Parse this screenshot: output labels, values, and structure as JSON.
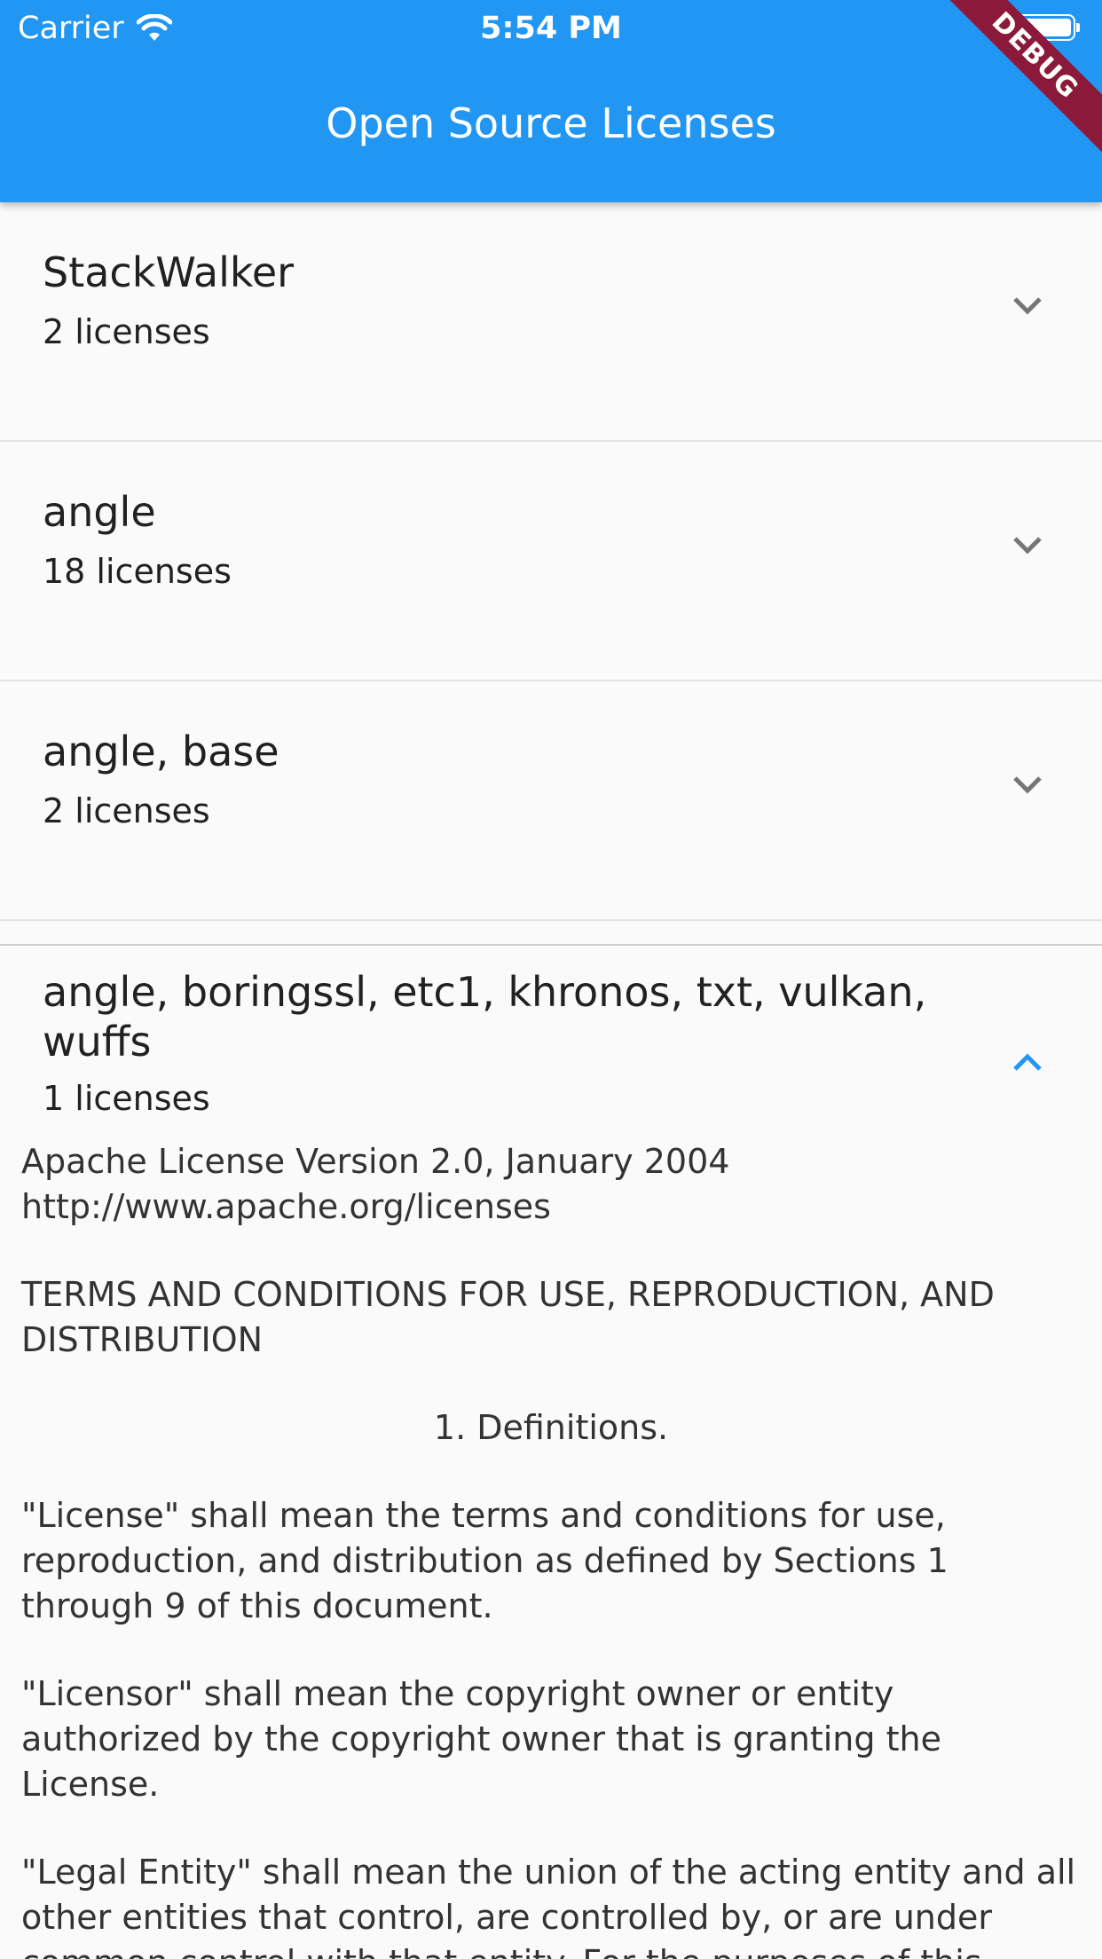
{
  "status_bar": {
    "carrier": "Carrier",
    "time": "5:54 PM"
  },
  "app_bar": {
    "title": "Open Source Licenses",
    "debug_banner": "DEBUG",
    "color": "#2196f3"
  },
  "packages": [
    {
      "name": "StackWalker",
      "count": "2 licenses",
      "icon": "chevron-down-icon"
    },
    {
      "name": "angle",
      "count": "18 licenses",
      "icon": "chevron-down-icon"
    },
    {
      "name": "angle, base",
      "count": "2 licenses",
      "icon": "chevron-down-icon"
    }
  ],
  "expanded": {
    "name": "angle, boringssl, etc1, khronos, txt, vulkan, wuffs",
    "count": "1 licenses",
    "icon": "chevron-up-icon",
    "accent": "#2196f3",
    "license_paragraphs": [
      "Apache License Version 2.0, January 2004\nhttp://www.apache.org/licenses",
      "TERMS AND CONDITIONS FOR USE, REPRODUCTION, AND DISTRIBUTION",
      "1. Definitions.",
      "\"License\" shall mean the terms and conditions for use, reproduction, and distribution as defined by Sections 1 through 9 of this document.",
      "\"Licensor\" shall mean the copyright owner or entity authorized by the copyright owner that is granting the License.",
      "\"Legal Entity\" shall mean the union of the acting entity and all other entities that control, are controlled by, or are under common control with that entity. For the purposes of this"
    ]
  }
}
